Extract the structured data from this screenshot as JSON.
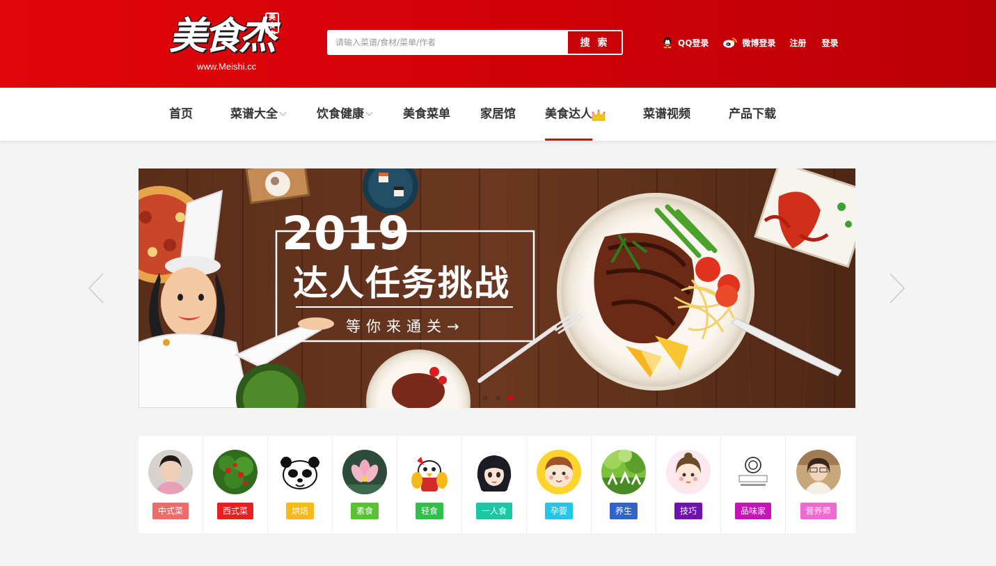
{
  "header": {
    "logo": {
      "title": "美食杰",
      "url": "www.Meishi.cc",
      "seal": "美食杰"
    },
    "search": {
      "placeholder": "请输入菜谱/食材/菜单/作者",
      "button": "搜 索"
    },
    "login": {
      "qq": "QQ登录",
      "weibo": "微博登录",
      "register": "注册",
      "signin": "登录"
    }
  },
  "nav": {
    "items": [
      "首页",
      "菜谱大全",
      "饮食健康",
      "美食菜单",
      "家居馆",
      "美食达人",
      "菜谱视频",
      "产品下载"
    ],
    "active": "美食达人"
  },
  "banner": {
    "year": "2019",
    "headline": "达人任务挑战",
    "subline": "等你来通关→"
  },
  "categories": [
    {
      "label": "中式菜",
      "color": "#f06a6a"
    },
    {
      "label": "西式菜",
      "color": "#e81f1f"
    },
    {
      "label": "烘焙",
      "color": "#f5b91c"
    },
    {
      "label": "素食",
      "color": "#58c233"
    },
    {
      "label": "轻食",
      "color": "#2ec04b"
    },
    {
      "label": "一人食",
      "color": "#19c7a4"
    },
    {
      "label": "孕婴",
      "color": "#24c6e8"
    },
    {
      "label": "养生",
      "color": "#3263c9"
    },
    {
      "label": "技巧",
      "color": "#6f13b0"
    },
    {
      "label": "品味家",
      "color": "#c814b5"
    },
    {
      "label": "营养师",
      "color": "#f267d0"
    }
  ]
}
